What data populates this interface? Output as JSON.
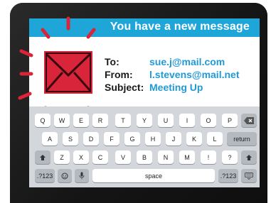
{
  "notification": {
    "title": "You have a new message",
    "to_label": "To:",
    "to_value": "sue.j@mail.com",
    "from_label": "From:",
    "from_value": "l.stevens@mail.net",
    "subject_label": "Subject:",
    "subject_value": "Meeting Up"
  },
  "keyboard": {
    "row1": [
      "Q",
      "W",
      "E",
      "R",
      "T",
      "Y",
      "U",
      "I",
      "O",
      "P"
    ],
    "row2": [
      "A",
      "S",
      "D",
      "F",
      "G",
      "H",
      "J",
      "K",
      "L"
    ],
    "row3": [
      "Z",
      "X",
      "C",
      "V",
      "B",
      "N",
      "M",
      "!",
      "?"
    ],
    "return_label": "return",
    "space_label": "space",
    "numbers_label": ".?123",
    "numbers_label_left": ".?123"
  },
  "icons": {
    "envelope": "envelope-icon",
    "delete": "backspace-icon",
    "shift": "shift-icon",
    "emoji": "emoji-icon",
    "mic": "microphone-icon",
    "hide_keyboard": "keyboard-hide-icon"
  },
  "colors": {
    "banner": "#1ea6d9",
    "accent_text": "#1f9ad6",
    "envelope": "#d9253a",
    "keyboard_bg": "#d3d6db"
  }
}
